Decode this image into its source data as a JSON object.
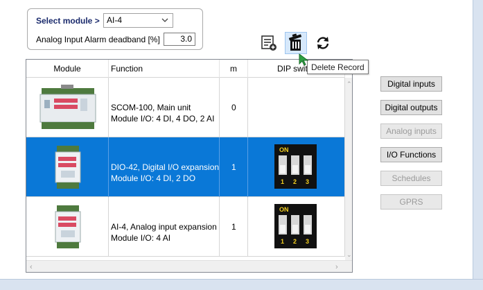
{
  "module_selector": {
    "label": "Select module >",
    "selected": "AI-4",
    "deadband_label": "Analog Input Alarm deadband [%]",
    "deadband_value": "3.0"
  },
  "toolbar": {
    "add_record_icon": "add-record-icon",
    "delete_record_icon": "trash-icon",
    "refresh_icon": "refresh-icon",
    "tooltip": "Delete Record"
  },
  "grid": {
    "columns": [
      "Module",
      "Function",
      "m",
      "DIP swit"
    ],
    "rows": [
      {
        "function_line1": "SCOM-100, Main unit",
        "function_line2": "Module I/O: 4 DI, 4 DO, 2 AI",
        "m": "0",
        "dip": ""
      },
      {
        "function_line1": "DIO-42, Digital I/O expansion",
        "function_line2": "Module I/O: 4 DI, 2 DO",
        "m": "1",
        "dip_on": "ON",
        "dip_nums": [
          "1",
          "2",
          "3"
        ]
      },
      {
        "function_line1": "AI-4, Analog input expansion",
        "function_line2": "Module I/O: 4 AI",
        "m": "1",
        "dip_on": "ON",
        "dip_nums": [
          "1",
          "2",
          "3"
        ]
      }
    ],
    "selected_row": 1
  },
  "side_buttons": [
    {
      "label": "Digital inputs",
      "enabled": true
    },
    {
      "label": "Digital outputs",
      "enabled": true
    },
    {
      "label": "Analog inputs",
      "enabled": false
    },
    {
      "label": "I/O Functions",
      "enabled": true
    },
    {
      "label": "Schedules",
      "enabled": false
    },
    {
      "label": "GPRS",
      "enabled": false
    }
  ],
  "colors": {
    "selection": "#0a78d7",
    "label_blue": "#1a2a6c",
    "cursor_green": "#2ea043"
  }
}
